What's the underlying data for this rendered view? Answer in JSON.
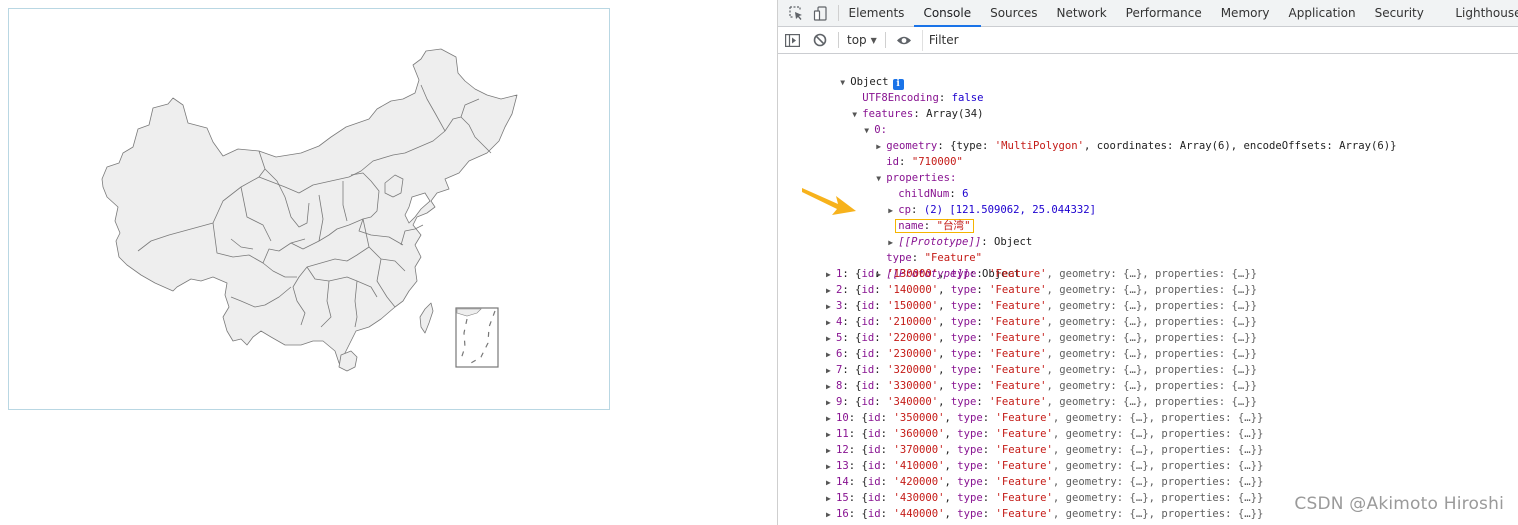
{
  "map": {
    "title": "China provinces map (ECharts geo)",
    "fill_color": "#eeeeee",
    "stroke_color": "#7a7a7a",
    "frame_color": "#b9d7e3"
  },
  "devtools": {
    "tabs": [
      {
        "label": "Elements",
        "active": false
      },
      {
        "label": "Console",
        "active": true
      },
      {
        "label": "Sources",
        "active": false
      },
      {
        "label": "Network",
        "active": false
      },
      {
        "label": "Performance",
        "active": false
      },
      {
        "label": "Memory",
        "active": false
      },
      {
        "label": "Application",
        "active": false
      },
      {
        "label": "Security",
        "active": false
      },
      {
        "label": "Lighthouse",
        "active": false
      }
    ],
    "toolbar": {
      "context": "top",
      "filter_placeholder": "Filter"
    },
    "accent_color": "#1a73e8"
  },
  "console": {
    "root_label": "Object",
    "utf8_key": "UTF8Encoding",
    "utf8_value": "false",
    "features_key": "features",
    "features_value": "Array(34)",
    "item0_label": "0:",
    "geometry_key": "geometry",
    "geometry_summary_prefix": "{type: ",
    "geometry_type": "'MultiPolygon'",
    "geometry_summary_suffix": ", coordinates: Array(6), encodeOffsets: Array(6)}",
    "id_key": "id",
    "id_value": "\"710000\"",
    "properties_key": "properties:",
    "childnum_key": "childNum",
    "childnum_value": "6",
    "cp_key": "cp",
    "cp_value": "(2) [121.509062, 25.044332]",
    "name_key": "name",
    "name_value": "\"台湾\"",
    "proto_label": "[[Prototype]]",
    "proto_value": ": Object",
    "type_key": "type",
    "type_value": "\"Feature\"",
    "rows": [
      {
        "index": "1",
        "id": "'130000'"
      },
      {
        "index": "2",
        "id": "'140000'"
      },
      {
        "index": "3",
        "id": "'150000'"
      },
      {
        "index": "4",
        "id": "'210000'"
      },
      {
        "index": "5",
        "id": "'220000'"
      },
      {
        "index": "6",
        "id": "'230000'"
      },
      {
        "index": "7",
        "id": "'320000'"
      },
      {
        "index": "8",
        "id": "'330000'"
      },
      {
        "index": "9",
        "id": "'340000'"
      },
      {
        "index": "10",
        "id": "'350000'"
      },
      {
        "index": "11",
        "id": "'360000'"
      },
      {
        "index": "12",
        "id": "'370000'"
      },
      {
        "index": "13",
        "id": "'410000'"
      },
      {
        "index": "14",
        "id": "'420000'"
      },
      {
        "index": "15",
        "id": "'430000'"
      },
      {
        "index": "16",
        "id": "'440000'"
      }
    ],
    "row_type": "'Feature'",
    "row_tail": ", geometry: {…}, properties: {…}}"
  },
  "highlight_color": "#f5b400",
  "watermark": "CSDN @Akimoto Hiroshi"
}
